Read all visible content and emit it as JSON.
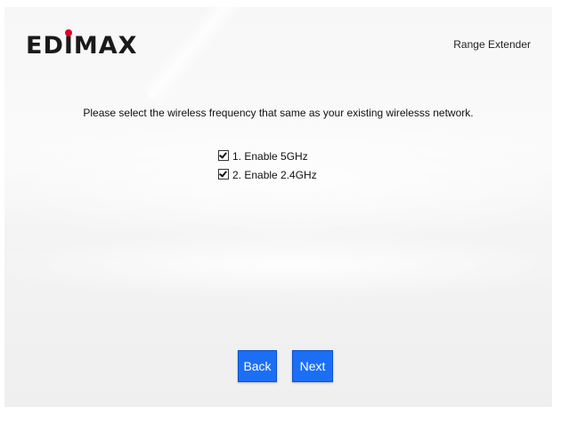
{
  "header": {
    "logo_text": "EDIMAX",
    "product_name": "Range Extender"
  },
  "main": {
    "instruction": "Please select the wireless frequency that same as your existing wirelesss network.",
    "options": [
      {
        "label": "1. Enable 5GHz",
        "checked": true
      },
      {
        "label": "2. Enable 2.4GHz",
        "checked": true
      }
    ]
  },
  "buttons": {
    "back_label": "Back",
    "next_label": "Next"
  },
  "colors": {
    "accent": "#1b6ff6",
    "logo_dot": "#e3002b"
  }
}
